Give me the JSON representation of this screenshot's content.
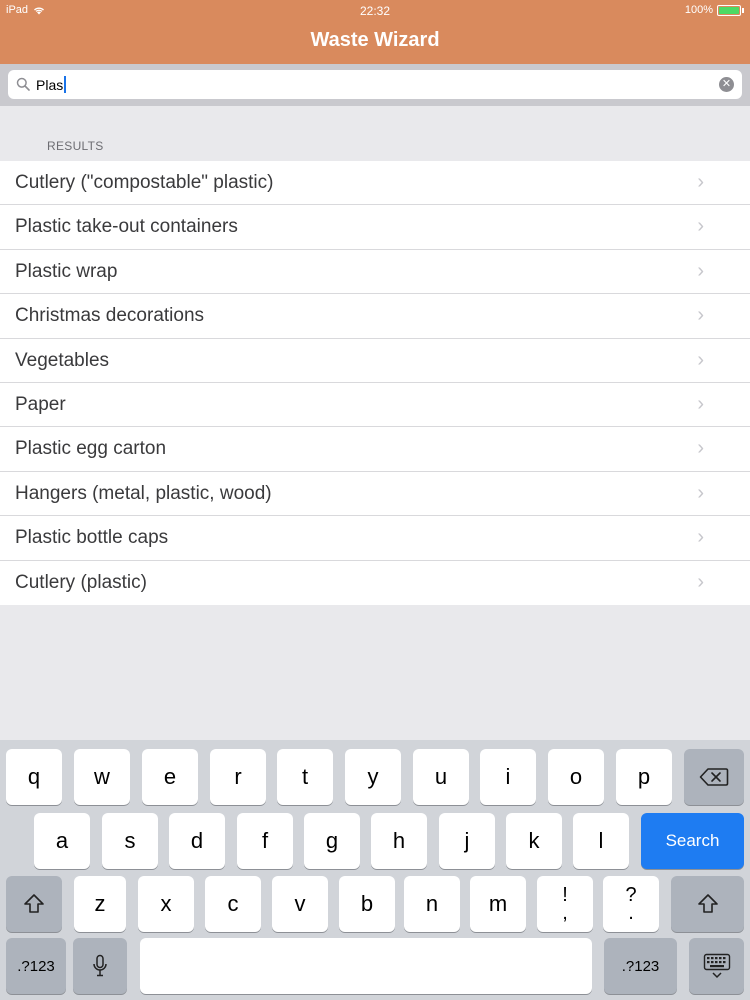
{
  "status": {
    "device": "iPad",
    "time": "22:32",
    "battery": "100%"
  },
  "header": {
    "title": "Waste Wizard"
  },
  "search": {
    "query": "Plas"
  },
  "results": {
    "section_title": "RESULTS",
    "items": [
      "Cutlery (\"compostable\" plastic)",
      "Plastic take-out containers",
      "Plastic wrap",
      "Christmas decorations",
      "Vegetables",
      "Paper",
      "Plastic egg carton",
      "Hangers (metal, plastic, wood)",
      "Plastic bottle caps",
      "Cutlery (plastic)"
    ]
  },
  "keyboard": {
    "row1": [
      "q",
      "w",
      "e",
      "r",
      "t",
      "y",
      "u",
      "i",
      "o",
      "p"
    ],
    "row2": [
      "a",
      "s",
      "d",
      "f",
      "g",
      "h",
      "j",
      "k",
      "l"
    ],
    "row3": [
      "z",
      "x",
      "c",
      "v",
      "b",
      "n",
      "m"
    ],
    "punct1": {
      "top": "!",
      "bottom": ","
    },
    "punct2": {
      "top": "?",
      "bottom": "."
    },
    "search_label": "Search",
    "numbers_label": ".?123"
  },
  "icons": {
    "chevron": "chevron-right-icon",
    "search": "magnifier-icon",
    "clear": "clear-x-icon",
    "backspace": "backspace-icon",
    "shift": "shift-arrow-icon",
    "mic": "microphone-icon",
    "hide_keyboard": "keyboard-dismiss-icon"
  },
  "colors": {
    "header": "#d98a5d",
    "search_key": "#1e7cf2"
  }
}
